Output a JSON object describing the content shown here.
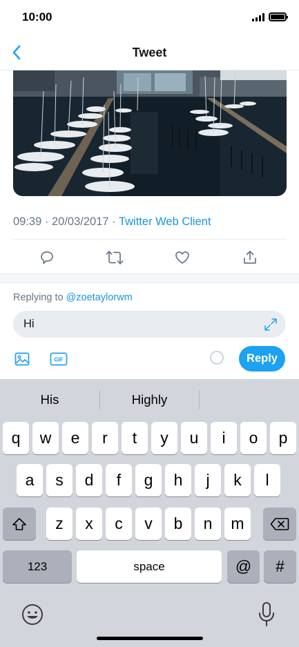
{
  "status_bar": {
    "time": "10:00"
  },
  "nav": {
    "title": "Tweet"
  },
  "tweet": {
    "time": "09:39",
    "date": "20/03/2017",
    "separator": "·",
    "client": "Twitter Web Client"
  },
  "reply": {
    "replying_prefix": "Replying to",
    "handle": "@zoetaylorwm",
    "text": "Hi",
    "button_label": "Reply",
    "gif_label": "GIF"
  },
  "keyboard": {
    "suggestions": [
      "His",
      "Highly",
      ""
    ],
    "row1": [
      "q",
      "w",
      "e",
      "r",
      "t",
      "y",
      "u",
      "i",
      "o",
      "p"
    ],
    "row2": [
      "a",
      "s",
      "d",
      "f",
      "g",
      "h",
      "j",
      "k",
      "l"
    ],
    "row3": [
      "z",
      "x",
      "c",
      "v",
      "b",
      "n",
      "m"
    ],
    "numbers_label": "123",
    "space_label": "space",
    "at_label": "@",
    "hash_label": "#"
  },
  "colors": {
    "accent": "#1da1f2",
    "link": "#1b95e0",
    "muted": "#657786"
  }
}
